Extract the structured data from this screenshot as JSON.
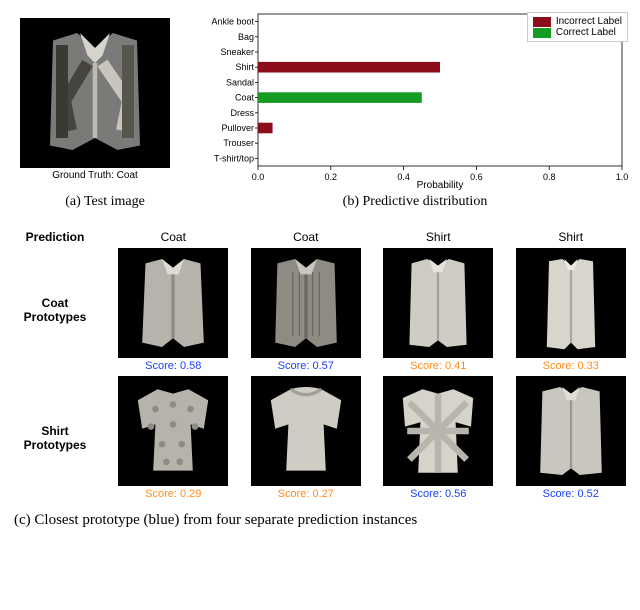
{
  "chart_data": {
    "type": "bar",
    "orientation": "horizontal",
    "title": "",
    "xlabel": "Probability",
    "ylabel": "",
    "xlim": [
      0,
      1.0
    ],
    "x_ticks": [
      0.0,
      0.2,
      0.4,
      0.6,
      0.8,
      1.0
    ],
    "categories": [
      "Ankle boot",
      "Bag",
      "Sneaker",
      "Shirt",
      "Sandal",
      "Coat",
      "Dress",
      "Pullover",
      "Trouser",
      "T-shirt/top"
    ],
    "series": [
      {
        "name": "Incorrect Label",
        "color": "#8b0e1a",
        "values": [
          0.0,
          0.0,
          0.0,
          0.5,
          0.0,
          0.0,
          0.0,
          0.04,
          0.0,
          0.0
        ]
      },
      {
        "name": "Correct Label",
        "color": "#169c23",
        "values": [
          0.0,
          0.0,
          0.0,
          0.0,
          0.0,
          0.45,
          0.0,
          0.0,
          0.0,
          0.0
        ]
      }
    ],
    "legend": [
      {
        "label": "Incorrect Label",
        "color": "#8b0e1a"
      },
      {
        "label": "Correct Label",
        "color": "#169c23"
      }
    ]
  },
  "test_image": {
    "ground_truth_prefix": "Ground Truth: ",
    "ground_truth_class": "Coat"
  },
  "captions": {
    "a": "(a) Test image",
    "b": "(b) Predictive distribution",
    "c": "(c) Closest prototype (blue) from four separate prediction instances"
  },
  "proto": {
    "header_prediction": "Prediction",
    "predictions": [
      "Coat",
      "Coat",
      "Shirt",
      "Shirt"
    ],
    "rows": [
      {
        "label_line1": "Coat",
        "label_line2": "Prototypes",
        "scores": [
          {
            "text": "Score: 0.58",
            "color": "blue"
          },
          {
            "text": "Score: 0.57",
            "color": "blue"
          },
          {
            "text": "Score: 0.41",
            "color": "orange"
          },
          {
            "text": "Score: 0.33",
            "color": "orange"
          }
        ]
      },
      {
        "label_line1": "Shirt",
        "label_line2": "Prototypes",
        "scores": [
          {
            "text": "Score: 0.29",
            "color": "orange"
          },
          {
            "text": "Score: 0.27",
            "color": "orange"
          },
          {
            "text": "Score: 0.56",
            "color": "blue"
          },
          {
            "text": "Score: 0.52",
            "color": "blue"
          }
        ]
      }
    ]
  }
}
